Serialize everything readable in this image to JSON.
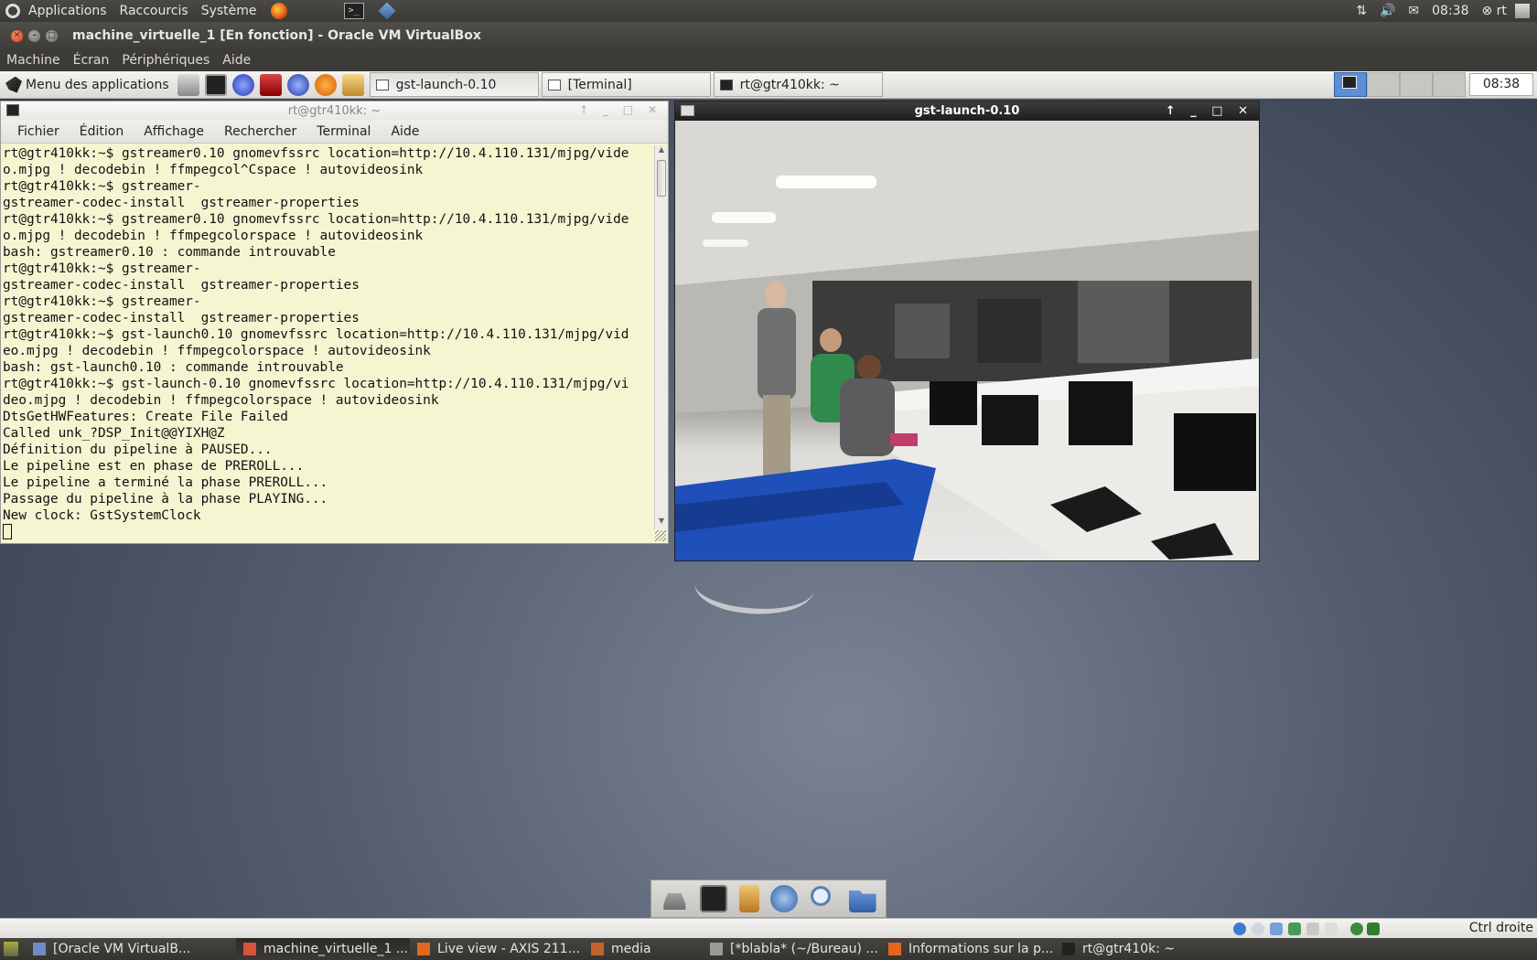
{
  "host_panel": {
    "menus": [
      "Applications",
      "Raccourcis",
      "Système"
    ],
    "clock": "08:38",
    "user": "rt"
  },
  "vbox": {
    "window_title": "machine_virtuelle_1 [En fonction] - Oracle VM VirtualBox",
    "menus": [
      "Machine",
      "Écran",
      "Périphériques",
      "Aide"
    ]
  },
  "guest_panel": {
    "app_menu_label": "Menu des applications",
    "tasks": [
      "gst-launch-0.10",
      "[Terminal]",
      "rt@gtr410kk: ~"
    ],
    "clock": "08:38"
  },
  "terminal": {
    "title": "rt@gtr410kk: ~",
    "menus": [
      "Fichier",
      "Édition",
      "Affichage",
      "Rechercher",
      "Terminal",
      "Aide"
    ],
    "lines": [
      "rt@gtr410kk:~$ gstreamer0.10 gnomevfssrc location=http://10.4.110.131/mjpg/vide",
      "o.mjpg ! decodebin ! ffmpegcol^Cspace ! autovideosink",
      "rt@gtr410kk:~$ gstreamer-",
      "gstreamer-codec-install  gstreamer-properties",
      "rt@gtr410kk:~$ gstreamer0.10 gnomevfssrc location=http://10.4.110.131/mjpg/vide",
      "o.mjpg ! decodebin ! ffmpegcolorspace ! autovideosink",
      "bash: gstreamer0.10 : commande introuvable",
      "rt@gtr410kk:~$ gstreamer-",
      "gstreamer-codec-install  gstreamer-properties",
      "rt@gtr410kk:~$ gstreamer-",
      "gstreamer-codec-install  gstreamer-properties",
      "rt@gtr410kk:~$ gst-launch0.10 gnomevfssrc location=http://10.4.110.131/mjpg/vid",
      "eo.mjpg ! decodebin ! ffmpegcolorspace ! autovideosink",
      "bash: gst-launch0.10 : commande introuvable",
      "rt@gtr410kk:~$ gst-launch-0.10 gnomevfssrc location=http://10.4.110.131/mjpg/vi",
      "deo.mjpg ! decodebin ! ffmpegcolorspace ! autovideosink",
      "DtsGetHWFeatures: Create File Failed",
      "Called unk_?DSP_Init@@YIXH@Z",
      "Définition du pipeline à PAUSED...",
      "Le pipeline est en phase de PREROLL...",
      "Le pipeline a terminé la phase PREROLL...",
      "Passage du pipeline à la phase PLAYING...",
      "New clock: GstSystemClock"
    ]
  },
  "gst_window": {
    "title": "gst-launch-0.10"
  },
  "dock": {
    "icons": [
      "drive-icon",
      "terminal-icon",
      "file-manager-icon",
      "web-browser-icon",
      "search-icon",
      "folder-icon"
    ]
  },
  "guest_status": {
    "host_key_label": "Ctrl droite"
  },
  "host_taskbar": {
    "items": [
      {
        "label": "[Oracle VM VirtualB...",
        "icon": "virtualbox-icon",
        "active": false
      },
      {
        "label": "machine_virtuelle_1 ...",
        "icon": "virtualbox-vm-icon",
        "active": true
      },
      {
        "label": "Live view - AXIS 211...",
        "icon": "firefox-icon",
        "active": false
      },
      {
        "label": "media",
        "icon": "folder-icon",
        "active": false
      },
      {
        "label": "[*blabla* (~/Bureau) ...",
        "icon": "text-editor-icon",
        "active": false
      },
      {
        "label": "Informations sur la p...",
        "icon": "firefox-icon",
        "active": false
      },
      {
        "label": "rt@gtr410k: ~",
        "icon": "terminal-icon",
        "active": false
      }
    ]
  }
}
